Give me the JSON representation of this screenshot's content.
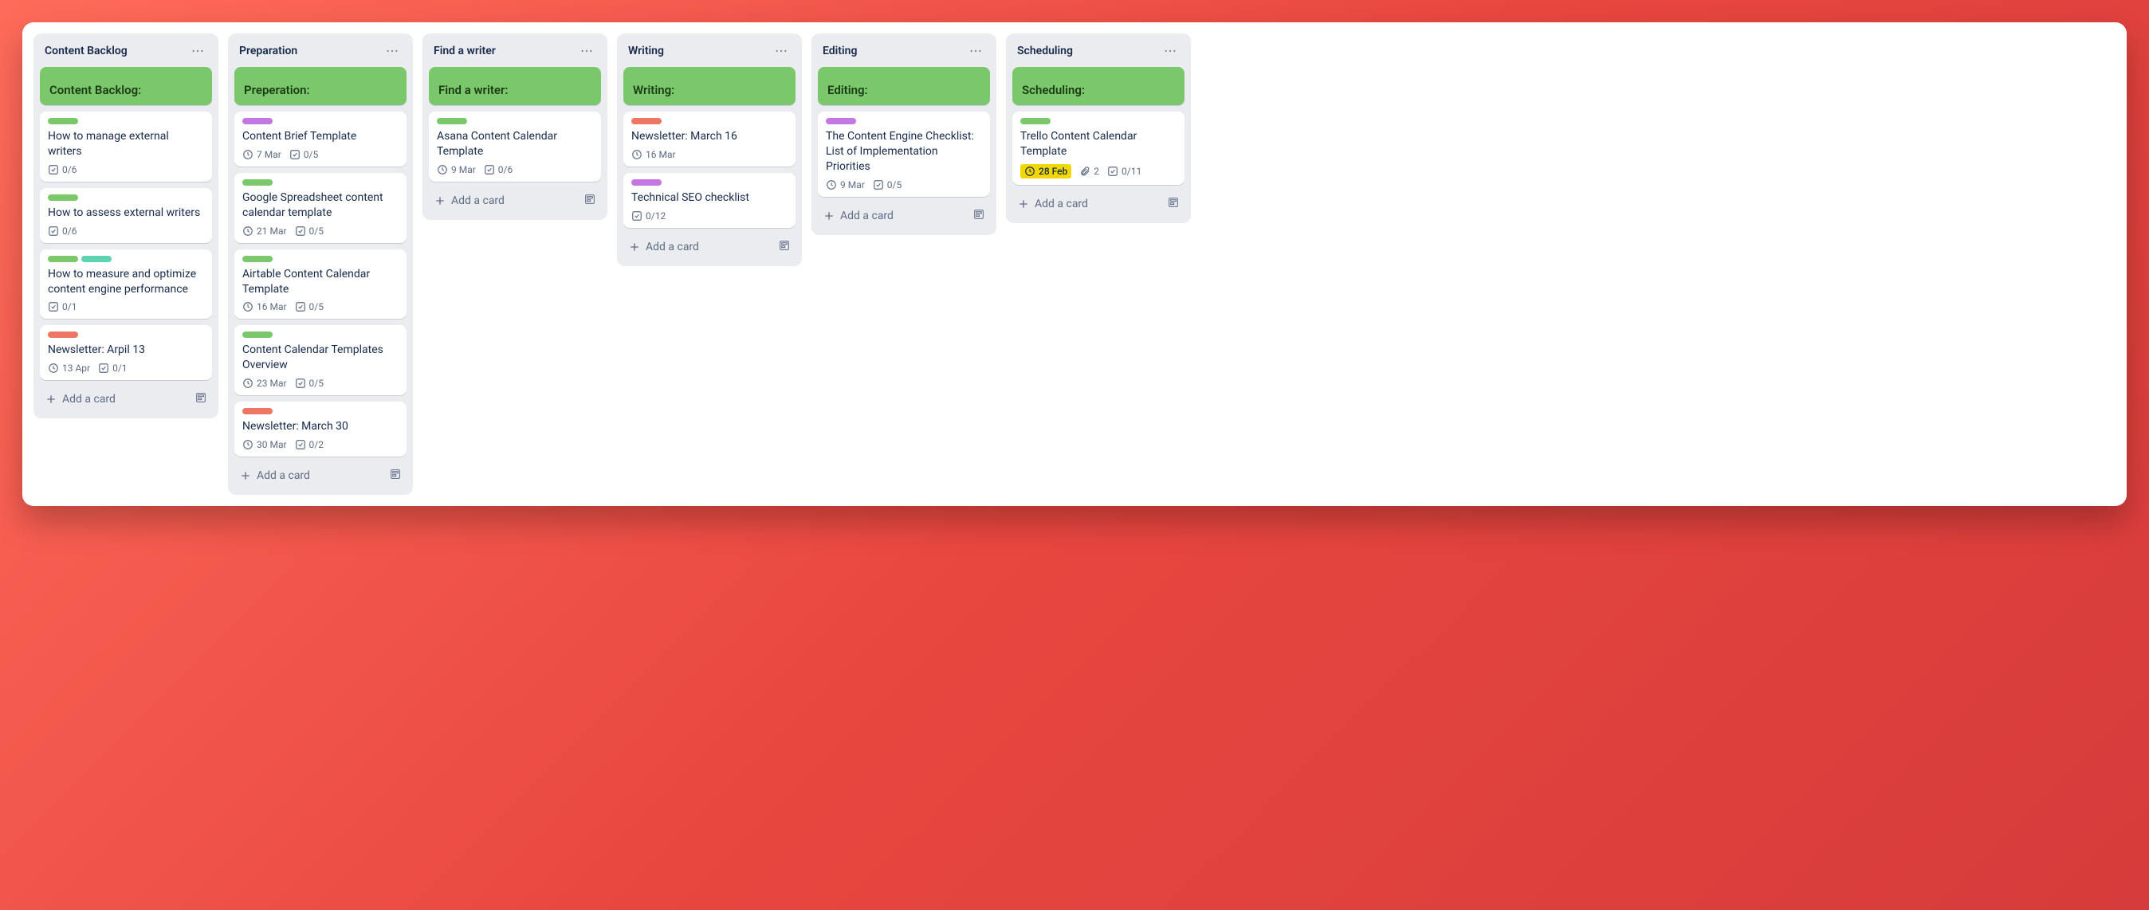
{
  "add_card_label": "Add a card",
  "lists": [
    {
      "title": "Content Backlog",
      "header_card": "Content Backlog:",
      "cards": [
        {
          "labels": [
            "green"
          ],
          "title": "How to manage external writers",
          "checklist": "0/6"
        },
        {
          "labels": [
            "green"
          ],
          "title": "How to assess external writers",
          "checklist": "0/6"
        },
        {
          "labels": [
            "green",
            "teal"
          ],
          "title": "How to measure and optimize content engine performance",
          "checklist": "0/1"
        },
        {
          "labels": [
            "orange"
          ],
          "title": "Newsletter: Arpil 13",
          "due": "13 Apr",
          "checklist": "0/1"
        }
      ]
    },
    {
      "title": "Preparation",
      "header_card": "Preperation:",
      "cards": [
        {
          "labels": [
            "purple"
          ],
          "title": "Content Brief Template",
          "due": "7 Mar",
          "checklist": "0/5"
        },
        {
          "labels": [
            "green"
          ],
          "title": "Google Spreadsheet content calendar template",
          "due": "21 Mar",
          "checklist": "0/5"
        },
        {
          "labels": [
            "green"
          ],
          "title": "Airtable Content Calendar Template",
          "due": "16 Mar",
          "checklist": "0/5"
        },
        {
          "labels": [
            "green"
          ],
          "title": "Content Calendar Templates Overview",
          "due": "23 Mar",
          "checklist": "0/5"
        },
        {
          "labels": [
            "orange"
          ],
          "title": "Newsletter: March 30",
          "due": "30 Mar",
          "checklist": "0/2"
        }
      ]
    },
    {
      "title": "Find a writer",
      "header_card": "Find a writer:",
      "cards": [
        {
          "labels": [
            "green"
          ],
          "title": "Asana Content Calendar Template",
          "due": "9 Mar",
          "checklist": "0/6"
        }
      ]
    },
    {
      "title": "Writing",
      "header_card": "Writing:",
      "cards": [
        {
          "labels": [
            "orange"
          ],
          "title": "Newsletter: March 16",
          "due": "16 Mar"
        },
        {
          "labels": [
            "purple"
          ],
          "title": "Technical SEO checklist",
          "checklist": "0/12"
        }
      ]
    },
    {
      "title": "Editing",
      "header_card": "Editing:",
      "cards": [
        {
          "labels": [
            "purple"
          ],
          "title": "The Content Engine Checklist: List of Implementation Priorities",
          "due": "9 Mar",
          "checklist": "0/5"
        }
      ]
    },
    {
      "title": "Scheduling",
      "header_card": "Scheduling:",
      "cards": [
        {
          "labels": [
            "green"
          ],
          "title": "Trello Content Calendar Template",
          "due": "28 Feb",
          "due_style": "yellow",
          "attachments": "2",
          "checklist": "0/11"
        }
      ]
    }
  ]
}
